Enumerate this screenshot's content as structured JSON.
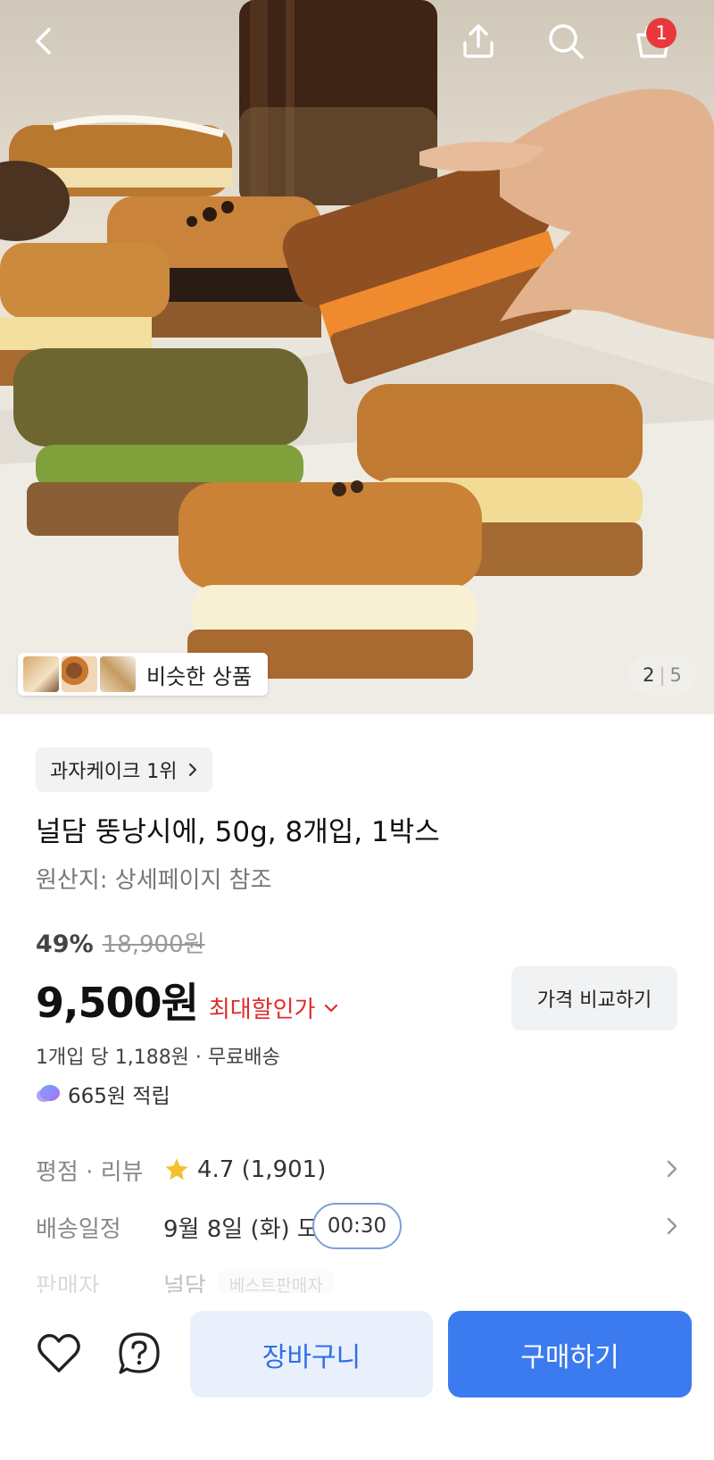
{
  "header": {
    "back_icon": "chevron-left-icon",
    "share_icon": "share-icon",
    "search_icon": "search-icon",
    "cart_icon": "shopping-bag-icon",
    "cart_count": "1"
  },
  "hero": {
    "similar_label": "비슷한 상품",
    "pager_current": "2",
    "pager_total": "5"
  },
  "product": {
    "rank_chip": "과자케이크 1위",
    "title": "널담 뚱낭시에, 50g, 8개입, 1박스",
    "origin": "원산지: 상세페이지 참조",
    "discount": "49%",
    "original_price": "18,900원",
    "price": "9,500원",
    "max_discount_label": "최대할인가",
    "compare_button": "가격 비교하기",
    "unit_price": "1개입 당 1,188원 · 무료배송",
    "points": "665원 적립"
  },
  "info": {
    "rating_label": "평점 · 리뷰",
    "rating_value": "4.7 (1,901)",
    "shipping_label": "배송일정",
    "shipping_value": "9월 8일 (화) 도",
    "shipping_timer": "00:30",
    "seller_label": "판매자",
    "seller_value": "널담",
    "seller_badge": "베스트판매자"
  },
  "bottom": {
    "wish_icon": "heart-icon",
    "qa_icon": "question-icon",
    "cart_button": "장바구니",
    "buy_button": "구매하기"
  },
  "colors": {
    "accent_blue": "#3b7bef",
    "discount_red": "#e02b2b",
    "badge_red": "#e8383d",
    "star_yellow": "#f5c02c"
  }
}
